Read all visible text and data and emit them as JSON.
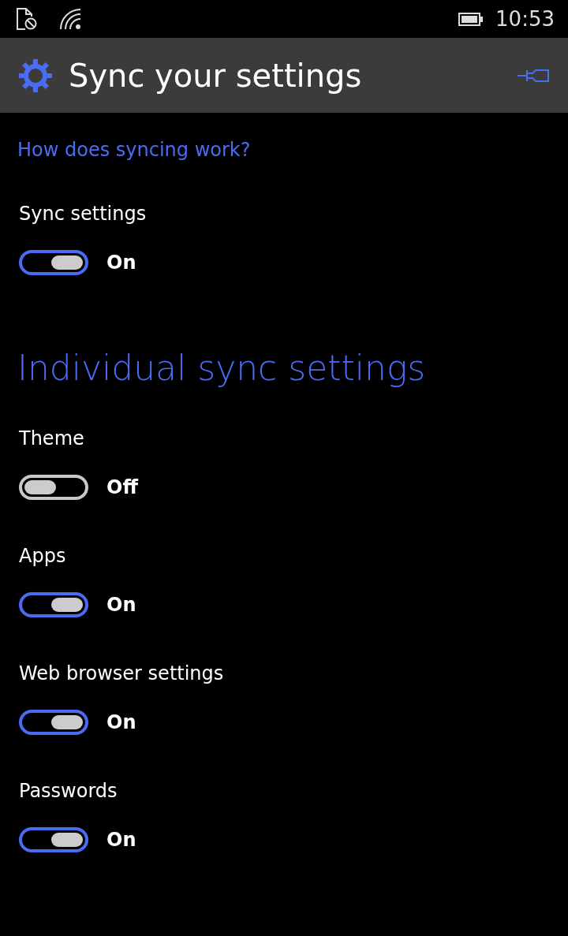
{
  "status_bar": {
    "time": "10:53"
  },
  "header": {
    "title": "Sync your settings"
  },
  "help_link": "How does syncing work?",
  "master": {
    "label": "Sync settings",
    "on": true,
    "state_text": "On"
  },
  "section": {
    "title": "Individual sync settings",
    "items": [
      {
        "label": "Theme",
        "on": false,
        "state_text": "Off"
      },
      {
        "label": "Apps",
        "on": true,
        "state_text": "On"
      },
      {
        "label": "Web browser settings",
        "on": true,
        "state_text": "On"
      },
      {
        "label": "Passwords",
        "on": true,
        "state_text": "On"
      }
    ]
  }
}
